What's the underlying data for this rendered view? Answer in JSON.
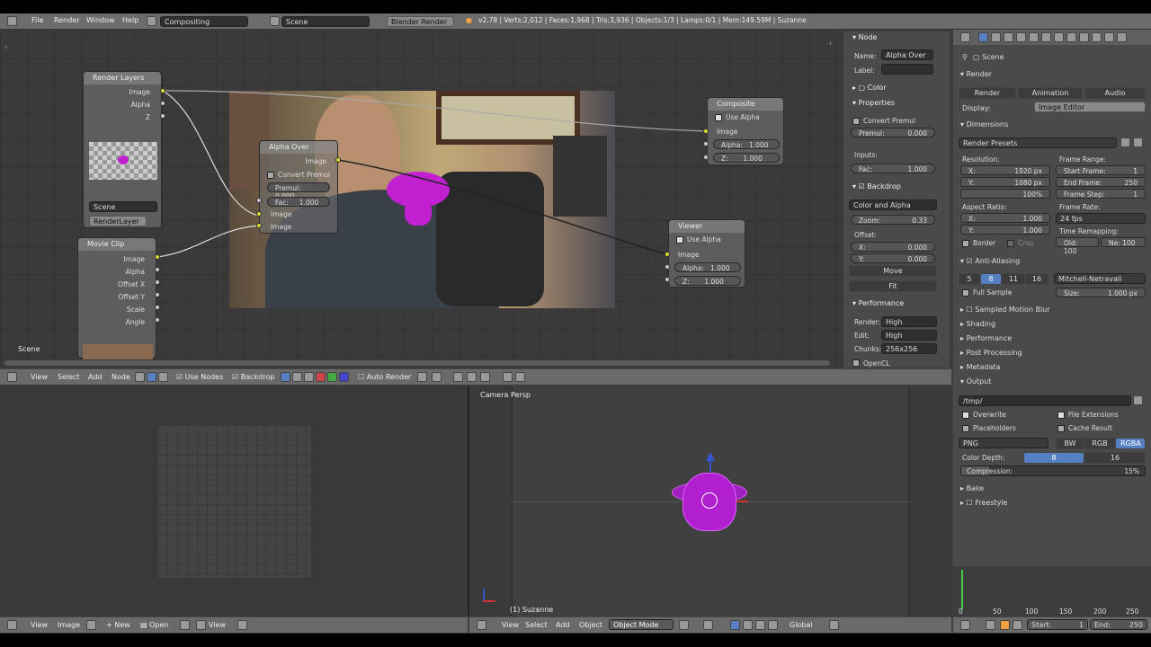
{
  "topbar": {
    "menu": [
      "File",
      "Render",
      "Window",
      "Help"
    ],
    "screen": "Compositing",
    "scene": "Scene",
    "engine": "Blender Render",
    "status": "v2.78 | Verts:2,012 | Faces:1,968 | Tris:3,936 | Objects:1/3 | Lamps:0/1 | Mem:149.59M | Suzanne"
  },
  "nodes": {
    "render_layers": {
      "title": "Render Layers",
      "outputs": [
        "Image",
        "Alpha",
        "Z"
      ],
      "scene": "Scene",
      "layer": "RenderLayer"
    },
    "alpha_over": {
      "title": "Alpha Over",
      "output": "Image",
      "convert": "Convert Premul",
      "premul_label": "Premul:",
      "premul_value": "0.000",
      "fac_label": "Fac:",
      "fac_value": "1.000",
      "inputs": [
        "Image",
        "Image"
      ]
    },
    "composite": {
      "title": "Composite",
      "use_alpha": "Use Alpha",
      "image": "Image",
      "alpha_label": "Alpha:",
      "alpha_value": "1.000",
      "z_label": "Z:",
      "z_value": "1.000"
    },
    "viewer": {
      "title": "Viewer",
      "use_alpha": "Use Alpha",
      "image": "Image",
      "alpha_label": "Alpha:",
      "alpha_value": "1.000",
      "z_label": "Z:",
      "z_value": "1.000"
    },
    "movie_clip": {
      "title": "Movie Clip",
      "outputs": [
        "Image",
        "Alpha",
        "Offset X",
        "Offset Y",
        "Scale",
        "Angle"
      ]
    }
  },
  "node_editor_label": "Scene",
  "sidebar": {
    "node_section": "Node",
    "name_label": "Name:",
    "name_value": "Alpha Over",
    "label_label": "Label:",
    "color_section": "Color",
    "properties_section": "Properties",
    "convert_premul": "Convert Premul",
    "premul_label": "Premul:",
    "premul_value": "0.000",
    "inputs_label": "Inputs:",
    "fac_label": "Fac:",
    "fac_value": "1.000",
    "backdrop_section": "Backdrop",
    "backdrop_mode": "Color and Alpha",
    "zoom_label": "Zoom:",
    "zoom_value": "0.33",
    "offset_label": "Offset:",
    "offx_label": "X:",
    "offx_value": "0.000",
    "offy_label": "Y:",
    "offy_value": "0.000",
    "move": "Move",
    "fit": "Fit",
    "performance_section": "Performance",
    "render_label": "Render:",
    "render_value": "High",
    "edit_label": "Edit:",
    "edit_value": "High",
    "chunks_label": "Chunks:",
    "chunks_value": "256x256",
    "opencl": "OpenCL"
  },
  "node_header": {
    "menus": [
      "View",
      "Select",
      "Add",
      "Node"
    ],
    "use_nodes": "Use Nodes",
    "backdrop": "Backdrop",
    "auto_render": "Auto Render"
  },
  "image_header": {
    "menus": [
      "View",
      "Image"
    ],
    "new": "New",
    "open": "Open",
    "view": "View"
  },
  "viewport": {
    "label": "Camera Persp",
    "object": "(1) Suzanne",
    "menus": [
      "View",
      "Select",
      "Add",
      "Object"
    ],
    "mode": "Object Mode",
    "orientation": "Global"
  },
  "properties": {
    "scene": "Scene",
    "render_section": "Render",
    "render_btn": "Render",
    "animation_btn": "Animation",
    "audio_btn": "Audio",
    "display_label": "Display:",
    "display_value": "Image Editor",
    "dimensions_section": "Dimensions",
    "render_presets": "Render Presets",
    "resolution_label": "Resolution:",
    "res_x": "X:",
    "res_x_value": "1920 px",
    "res_y": "Y:",
    "res_y_value": "1080 px",
    "res_pct": "100%",
    "frame_range_label": "Frame Range:",
    "start_frame": "Start Frame:",
    "start_frame_value": "1",
    "end_frame": "End Frame:",
    "end_frame_value": "250",
    "frame_step": "Frame Step:",
    "frame_step_value": "1",
    "aspect_label": "Aspect Ratio:",
    "asp_x": "X:",
    "asp_x_value": "1.000",
    "asp_y": "Y:",
    "asp_y_value": "1.000",
    "frame_rate_label": "Frame Rate:",
    "frame_rate_value": "24 fps",
    "time_remap_label": "Time Remapping:",
    "time_old": "Old: 100",
    "time_new": "Ne: 100",
    "border": "Border",
    "crop": "Crop",
    "aa_section": "Anti-Aliasing",
    "aa_samples": [
      "5",
      "8",
      "11",
      "16"
    ],
    "aa_filter": "Mitchell-Netravali",
    "full_sample": "Full Sample",
    "size_label": "Size:",
    "size_value": "1.000 px",
    "sampled_motion_blur": "Sampled Motion Blur",
    "shading": "Shading",
    "performance": "Performance",
    "post_processing": "Post Processing",
    "metadata": "Metadata",
    "output_section": "Output",
    "output_path": "/tmp/",
    "overwrite": "Overwrite",
    "file_extensions": "File Extensions",
    "placeholders": "Placeholders",
    "cache_result": "Cache Result",
    "format": "PNG",
    "bw": "BW",
    "rgb": "RGB",
    "rgba": "RGBA",
    "color_depth_label": "Color Depth:",
    "depth_8": "8",
    "depth_16": "16",
    "compression_label": "Compression:",
    "compression_value": "15%",
    "compression_fraction": 0.15,
    "bake": "Bake",
    "freestyle": "Freestyle"
  },
  "timeline": {
    "ticks": [
      "0",
      "50",
      "100",
      "150",
      "200",
      "250"
    ],
    "start_label": "Start:",
    "start_value": "1",
    "end_label": "End:",
    "end_value": "250"
  }
}
